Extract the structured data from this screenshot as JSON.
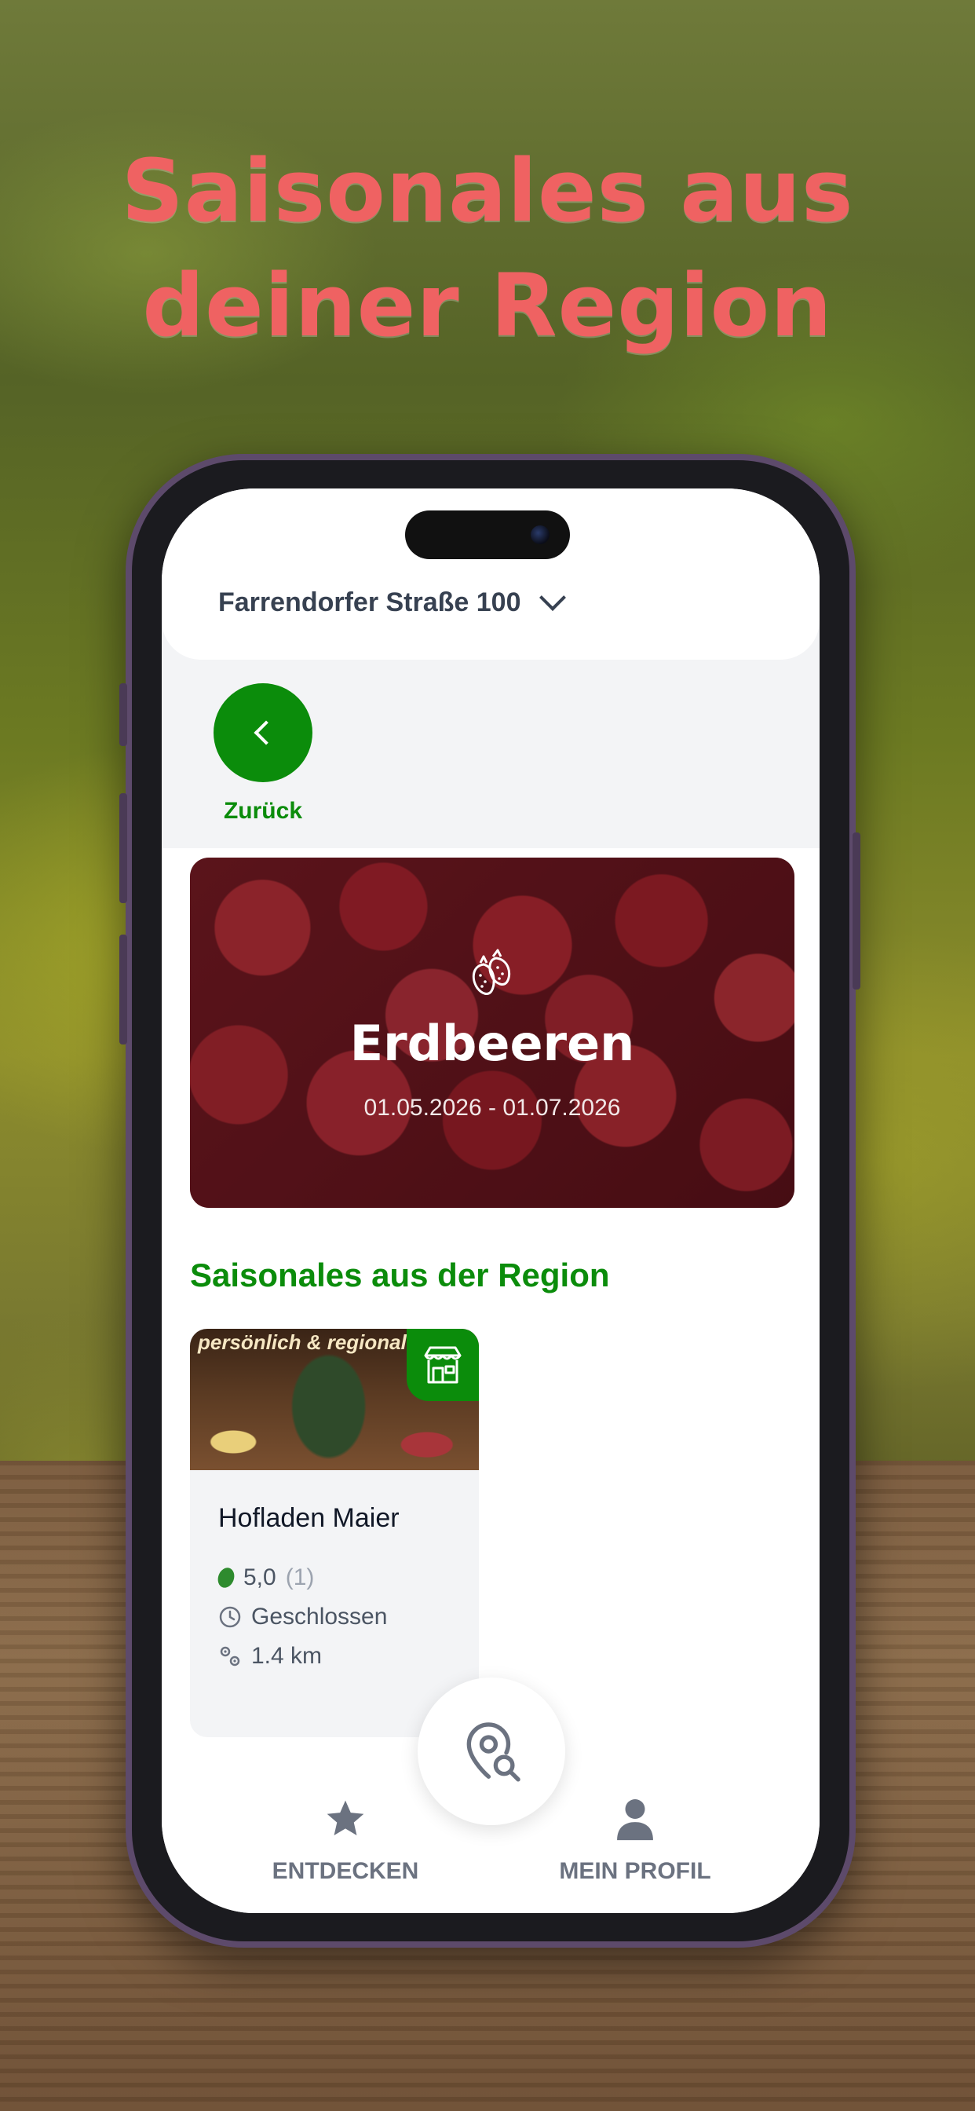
{
  "marketing": {
    "headline_line1": "Saisonales aus",
    "headline_line2": "deiner Region"
  },
  "header": {
    "address": "Farrendorfer Straße 100",
    "address_icon": "chevron-down-icon"
  },
  "back": {
    "label": "Zurück",
    "icon": "chevron-left-icon"
  },
  "hero": {
    "icon": "strawberry-icon",
    "title": "Erdbeeren",
    "dates": "01.05.2026 - 01.07.2026"
  },
  "section": {
    "title": "Saisonales aus der Region"
  },
  "shop_card": {
    "image_text": "persönlich & regional",
    "badge_icon": "market-stall-icon",
    "name": "Hofladen Maier",
    "rating": "5,0",
    "rating_count": "(1)",
    "status": "Geschlossen",
    "distance": "1.4 km"
  },
  "nav": {
    "discover_label": "ENTDECKEN",
    "profile_label": "MEIN PROFIL",
    "search_icon": "location-search-icon"
  },
  "colors": {
    "accent_green": "#0b8c0b",
    "headline_coral": "#ef6262",
    "nav_gray": "#6b7280"
  }
}
